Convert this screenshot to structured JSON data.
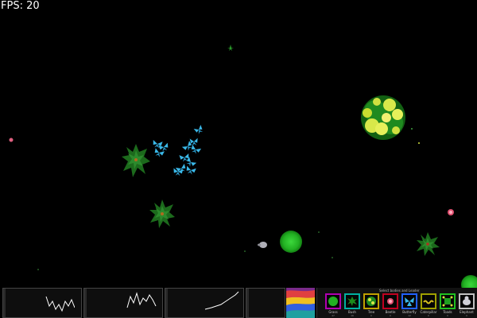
{
  "hud": {
    "fps_text": "FPS: 20"
  },
  "palette": {
    "title": "Select bodies and Leader",
    "tools": [
      {
        "label": "Grass",
        "count": "47",
        "color": "#b000b0"
      },
      {
        "label": "Bush",
        "count": "16",
        "color": "#00b0a0"
      },
      {
        "label": "Tree",
        "count": "0",
        "color": "#c0a000"
      },
      {
        "label": "Beetle",
        "count": "0",
        "color": "#c00020"
      },
      {
        "label": "Butterfly",
        "count": "12",
        "color": "#2060ff"
      },
      {
        "label": "Caterpillar",
        "count": "0",
        "color": "#a0a000"
      },
      {
        "label": "Toads",
        "count": "0",
        "color": "#20c020"
      },
      {
        "label": "Elephant",
        "count": "0",
        "color": "#c0c0c0"
      }
    ]
  },
  "graphs": [
    {
      "name": "graph-1",
      "value": ""
    },
    {
      "name": "graph-2",
      "value": ""
    },
    {
      "name": "graph-3",
      "value": ""
    },
    {
      "name": "graph-4",
      "value": ""
    }
  ]
}
